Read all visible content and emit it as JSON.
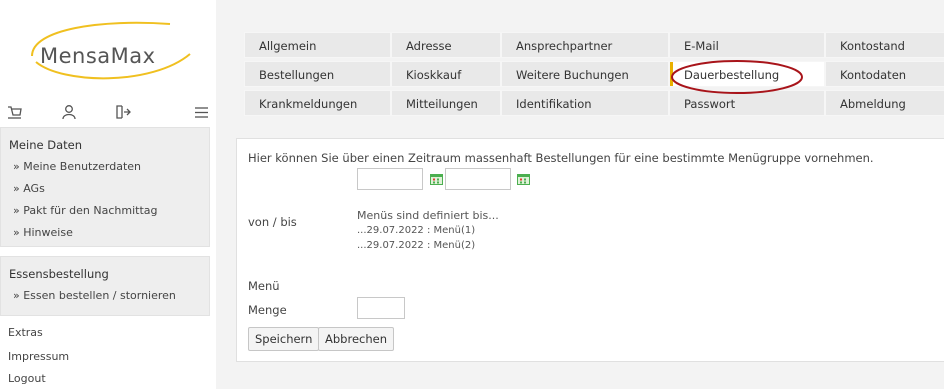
{
  "brand": {
    "name": "MensaMax"
  },
  "toolbar_icons": [
    "cart-icon",
    "user-icon",
    "logout-icon",
    "menu-icon"
  ],
  "sidebar": {
    "meine_daten": {
      "title": "Meine Daten",
      "items": [
        "» Meine Benutzerdaten",
        "» AGs",
        "» Pakt für den Nachmittag",
        "» Hinweise"
      ]
    },
    "essensbestellung": {
      "title": "Essensbestellung",
      "items": [
        "» Essen bestellen / stornieren"
      ]
    },
    "links": [
      "Extras",
      "Impressum",
      "Logout"
    ]
  },
  "tabs": [
    [
      "Allgemein",
      "Adresse",
      "Ansprechpartner",
      "E-Mail",
      "Kontostand"
    ],
    [
      "Bestellungen",
      "Kioskkauf",
      "Weitere Buchungen",
      "Dauerbestellung",
      "Kontodaten"
    ],
    [
      "Krankmeldungen",
      "Mitteilungen",
      "Identifikation",
      "Passwort",
      "Abmeldung"
    ]
  ],
  "active_tab": "Dauerbestellung",
  "form": {
    "intro": "Hier können Sie über einen Zeitraum massenhaft Bestellungen für eine bestimmte Menügruppe vornehmen.",
    "date_from": "",
    "date_to": "",
    "von_bis_label": "von / bis",
    "definition_title": "Menüs sind definiert bis...",
    "definitions": [
      "...29.07.2022 : Menü(1)",
      "...29.07.2022 : Menü(2)"
    ],
    "menu_label": "Menü",
    "menge_label": "Menge",
    "menge_value": "",
    "save_label": "Speichern",
    "cancel_label": "Abbrechen"
  },
  "colors": {
    "accent": "#e9b000",
    "logo_swoosh": "#f0c020",
    "highlight": "#a8141a",
    "calendar_icon": "#4caf50"
  }
}
